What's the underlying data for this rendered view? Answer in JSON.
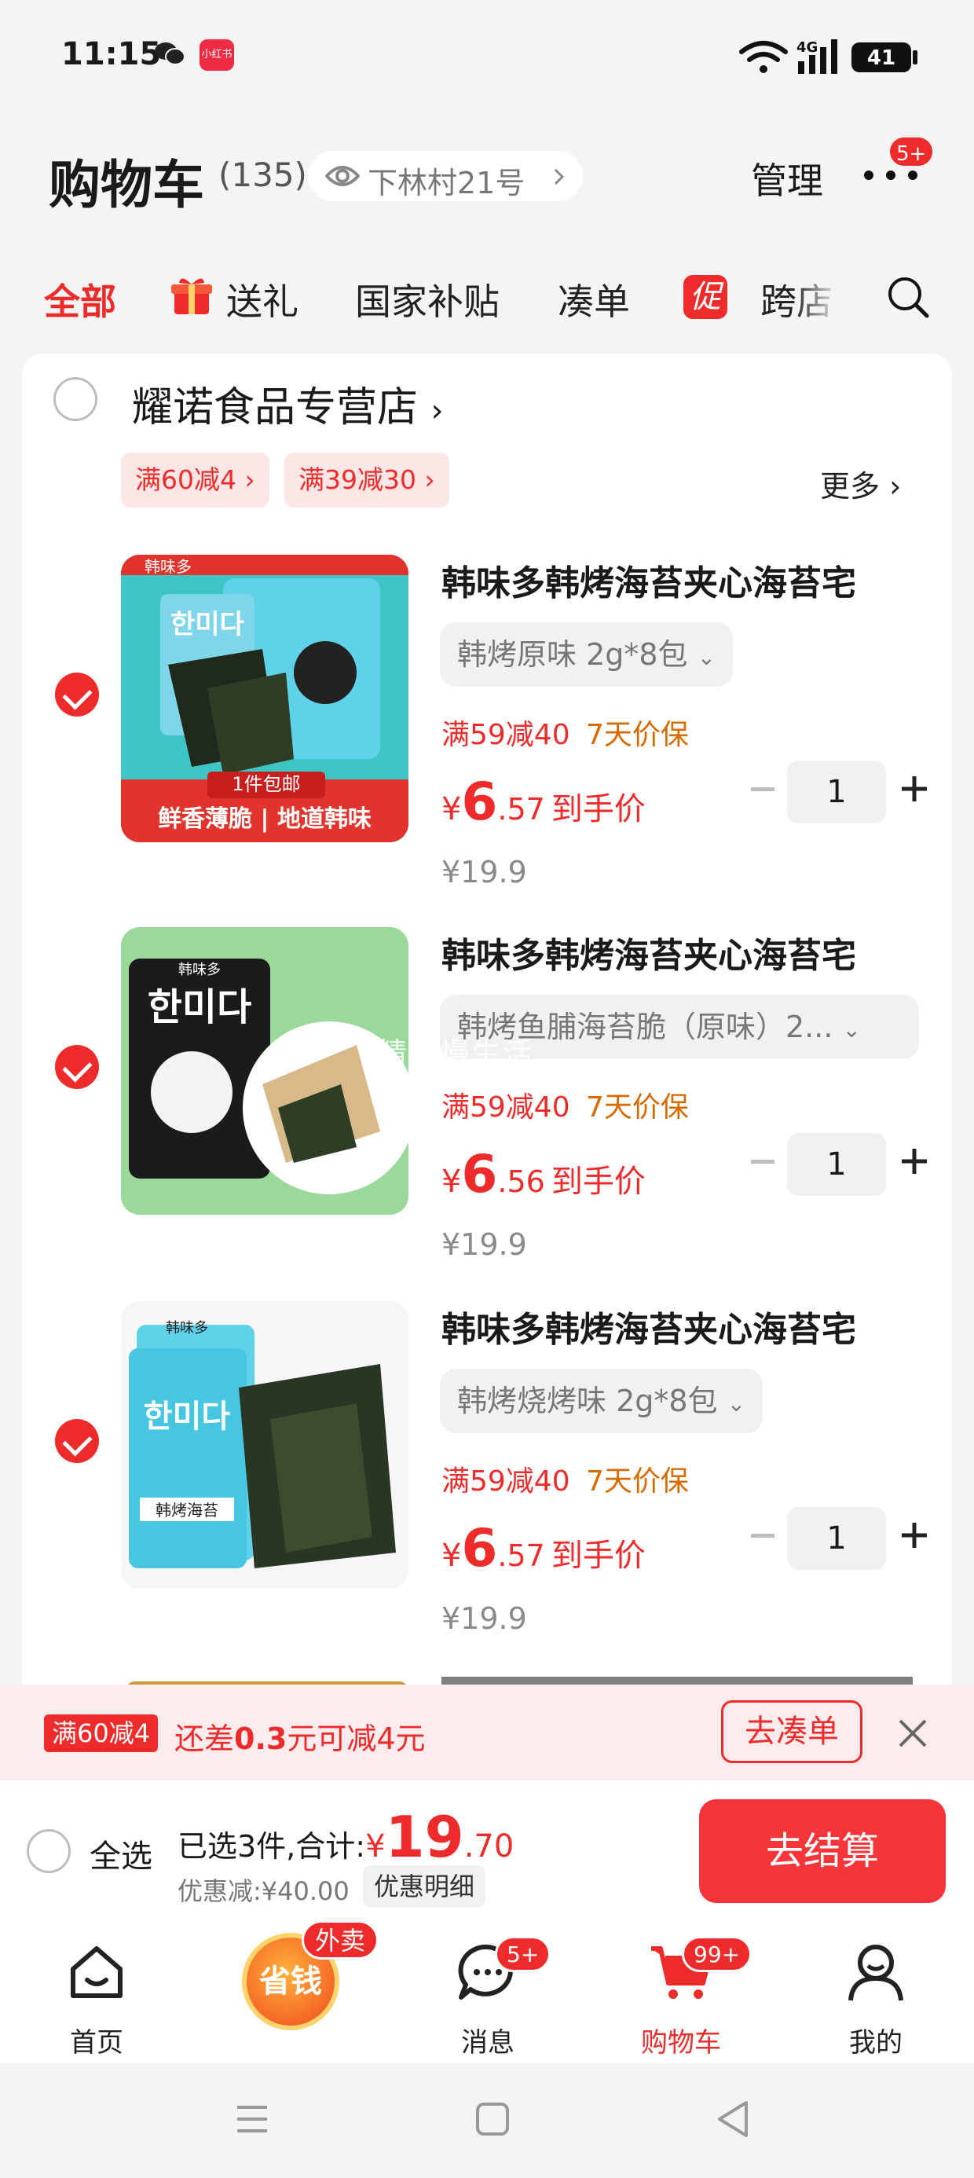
{
  "status_bar": {
    "time": "11:15",
    "app_badge": "小红书",
    "network": "4G",
    "battery": "41"
  },
  "header": {
    "title": "购物车",
    "count": "(135)",
    "address": "下林村21号",
    "manage_label": "管理",
    "more_badge": "5+"
  },
  "tabs": [
    {
      "label": "全部",
      "active": true
    },
    {
      "label": "送礼",
      "icon": "gift-icon"
    },
    {
      "label": "国家补贴"
    },
    {
      "label": "凑单"
    },
    {
      "label": "跨店",
      "icon": "promo-icon",
      "icon_text": "促"
    }
  ],
  "store": {
    "name": "耀诺食品专营店",
    "coupons": [
      "满60减4",
      "满39减30"
    ],
    "more_label": "更多"
  },
  "items": [
    {
      "name": "韩味多韩烤海苔夹心海苔宅",
      "spec": "韩烤原味 2g*8包",
      "tag1": "满59减40",
      "tag2": "7天价保",
      "price_currency": "¥",
      "price_int": "6",
      "price_dec": ".57",
      "price_label": "到手价",
      "original_price": "¥19.9",
      "quantity": "1",
      "checked": true,
      "thumb_texts": {
        "brand": "韩味多",
        "kr": "한미다",
        "banner": "1件包邮",
        "slogan": "鲜香薄脆 | 地道韩味"
      }
    },
    {
      "name": "韩味多韩烤海苔夹心海苔宅",
      "spec": "韩烤鱼脯海苔脆（原味）2...",
      "tag1": "满59减40",
      "tag2": "7天价保",
      "price_currency": "¥",
      "price_int": "6",
      "price_dec": ".56",
      "price_label": "到手价",
      "original_price": "¥19.9",
      "quantity": "1",
      "checked": true,
      "thumb_texts": {
        "brand": "韩味多",
        "kr": "한미다"
      }
    },
    {
      "name": "韩味多韩烤海苔夹心海苔宅",
      "spec": "韩烤烧烤味 2g*8包",
      "tag1": "满59减40",
      "tag2": "7天价保",
      "price_currency": "¥",
      "price_int": "6",
      "price_dec": ".57",
      "price_label": "到手价",
      "original_price": "¥19.9",
      "quantity": "1",
      "checked": true,
      "thumb_texts": {
        "brand": "韩味多",
        "kr": "한미다",
        "sub": "韩烤海苔"
      }
    }
  ],
  "watermark": "精致慢生活",
  "promo_bar": {
    "badge": "满60减4",
    "prefix": "还差",
    "amount": "0.3",
    "suffix": "元可减4元",
    "button": "去凑单"
  },
  "checkout": {
    "select_all": "全选",
    "summary_prefix": "已选3件,合计:",
    "total_currency": "¥",
    "total_int": "19",
    "total_dec": ".70",
    "discount": "优惠减:¥40.00",
    "detail_button": "优惠明细",
    "pay_button": "去结算"
  },
  "bottom_nav": [
    {
      "label": "首页",
      "icon": "home-icon"
    },
    {
      "label": "省钱",
      "icon": "save-money-icon",
      "badge": "外卖"
    },
    {
      "label": "消息",
      "icon": "message-icon",
      "badge": "5+"
    },
    {
      "label": "购物车",
      "icon": "cart-icon",
      "badge": "99+",
      "active": true
    },
    {
      "label": "我的",
      "icon": "profile-icon"
    }
  ],
  "colors": {
    "accent": "#ee2b2b",
    "price_guard": "#d66b00",
    "background": "#f4f4f4"
  }
}
